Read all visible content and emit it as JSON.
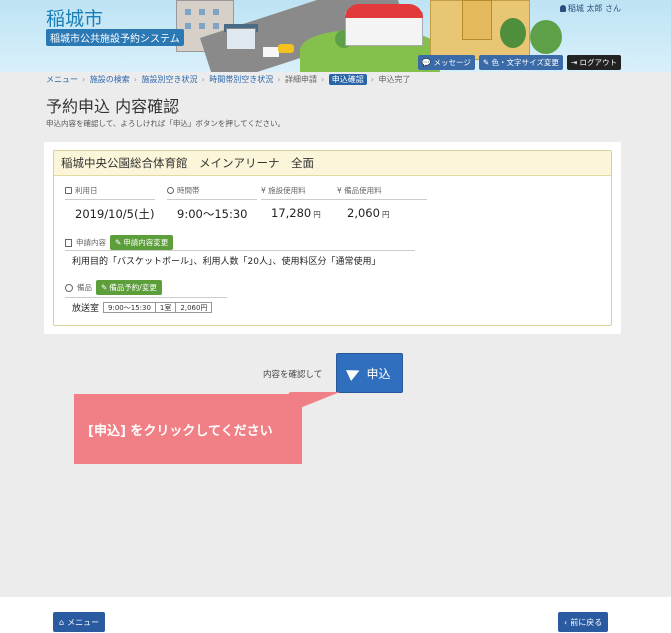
{
  "header": {
    "city": "稲城市",
    "system": "稲城市公共施設予約システム",
    "user": "稲城 太郎 さん",
    "buttons": {
      "message": "メッセージ",
      "text_size": "色・文字サイズ変更",
      "logout": "ログアウト"
    }
  },
  "breadcrumb": {
    "items": [
      "メニュー",
      "施設の検索",
      "施設別空き状況",
      "時間帯別空き状況",
      "詳細申請",
      "申込確認",
      "申込完了"
    ],
    "current": "申込確認"
  },
  "page": {
    "title": "予約申込 内容確認",
    "description": "申込内容を確認して、よろしければ「申込」ボタンを押してください。"
  },
  "card": {
    "facility": "稲城中央公園総合体育館　メインアリーナ　全面",
    "fields": {
      "date_label": "利用日",
      "date_value": "2019/10/5(土)",
      "time_label": "時間帯",
      "time_value": "9:00〜15:30",
      "facility_fee_label": "施設使用料",
      "facility_fee_value": "17,280",
      "equip_fee_label": "備品使用料",
      "equip_fee_value": "2,060",
      "unit": "円"
    },
    "application": {
      "label": "申請内容",
      "edit_button": "申請内容変更",
      "purpose": "利用目的「バスケットボール」、利用人数「20人」、使用料区分「通常使用」"
    },
    "equipment": {
      "label": "備品",
      "edit_button": "備品予約/変更",
      "item": "放送室",
      "tags": [
        "9:00〜15:30",
        "1室",
        "2,060円"
      ]
    }
  },
  "submit": {
    "prompt": "内容を確認して",
    "button": "申込",
    "callout": "[申込] をクリックしてください"
  },
  "footer": {
    "menu": "メニュー",
    "back": "前に戻る"
  }
}
